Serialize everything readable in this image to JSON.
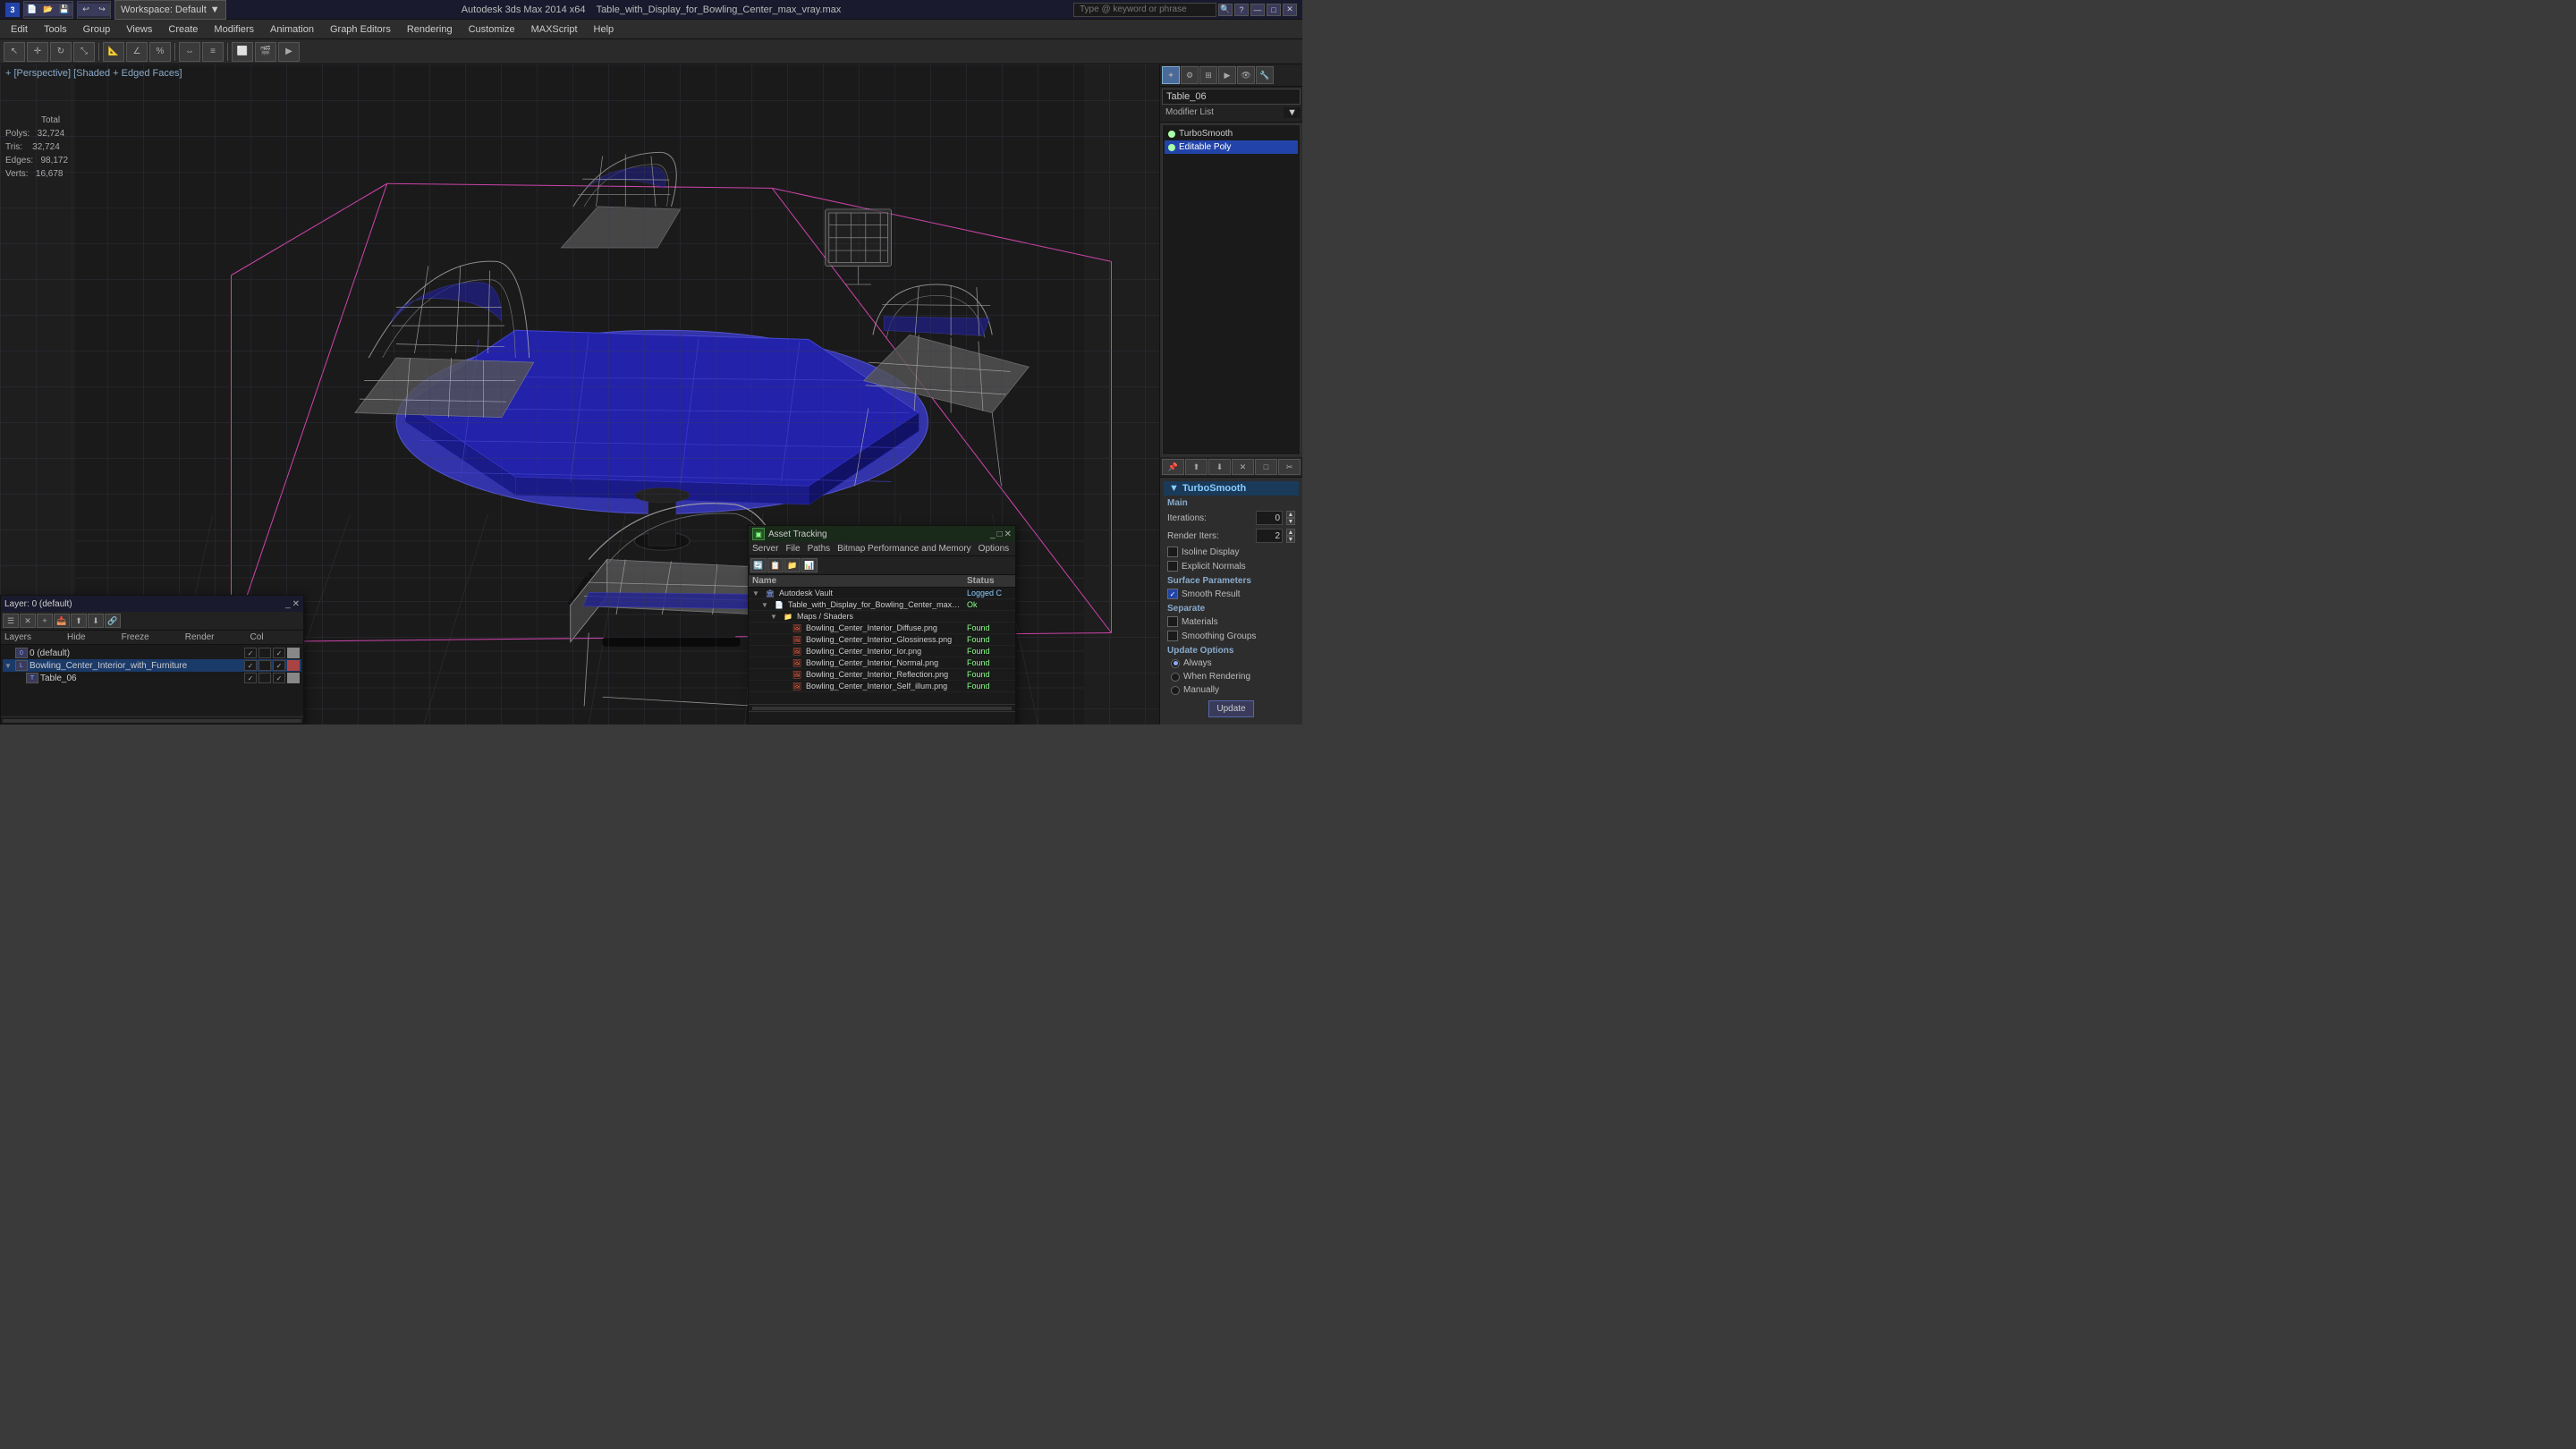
{
  "titlebar": {
    "app_name": "Autodesk 3ds Max 2014 x64",
    "file_name": "Table_with_Display_for_Bowling_Center_max_vray.max",
    "workspace": "Workspace: Default",
    "min_btn": "—",
    "max_btn": "□",
    "close_btn": "✕"
  },
  "search": {
    "placeholder": "Type @ keyword or phrase"
  },
  "menubar": {
    "items": [
      "Edit",
      "Tools",
      "Group",
      "Views",
      "Create",
      "Modifiers",
      "Animation",
      "Graph Editors",
      "Rendering",
      "Customize",
      "MAXScript",
      "Help"
    ]
  },
  "viewport": {
    "label": "+ [Perspective] [Shaded + Edged Faces]",
    "stats": {
      "polys_label": "Polys:",
      "polys_total": "Total",
      "polys_val": "32,724",
      "tris_label": "Tris:",
      "tris_val": "32,724",
      "edges_label": "Edges:",
      "edges_val": "98,172",
      "verts_label": "Verts:",
      "verts_val": "16,678"
    }
  },
  "right_panel": {
    "icons": [
      "☀",
      "⚙",
      "📷",
      "🔧",
      "💡",
      "📱"
    ],
    "object_name": "Table_06",
    "modifier_list_label": "Modifier List",
    "modifiers": [
      {
        "name": "TurboSmooth",
        "active": true
      },
      {
        "name": "Editable Poly",
        "active": true
      }
    ],
    "stack_buttons": [
      "📌",
      "⬆",
      "⬇",
      "✕",
      "□",
      "✂"
    ],
    "turbosmooth": {
      "title": "TurboSmooth",
      "main_label": "Main",
      "iterations_label": "Iterations:",
      "iterations_val": "0",
      "render_iters_label": "Render Iters:",
      "render_iters_val": "2",
      "isoline_label": "Isoline Display",
      "isoline_checked": false,
      "explicit_label": "Explicit Normals",
      "explicit_checked": false,
      "surface_label": "Surface Parameters",
      "smooth_label": "Smooth Result",
      "smooth_checked": true,
      "separate_label": "Separate",
      "materials_label": "Materials",
      "materials_checked": false,
      "smoothing_label": "Smoothing Groups",
      "smoothing_checked": false,
      "update_label": "Update Options",
      "always_label": "Always",
      "always_selected": true,
      "when_rendering_label": "When Rendering",
      "when_rendering_selected": false,
      "manually_label": "Manually",
      "manually_selected": false,
      "update_btn_label": "Update"
    }
  },
  "layers_panel": {
    "title": "Layer: 0 (default)",
    "toolbar_items": [
      "☰",
      "✕",
      "+",
      "📥",
      "⬆",
      "⬇",
      "🔗"
    ],
    "header_cols": [
      "Layers",
      "Hide",
      "Freeze",
      "Render",
      "Col"
    ],
    "layers": [
      {
        "indent": 0,
        "expand": "",
        "name": "0 (default)",
        "visible": true,
        "selected": false
      },
      {
        "indent": 1,
        "expand": "▼",
        "name": "Bowling_Center_Interior_with_Furniture",
        "visible": true,
        "selected": true,
        "color": "#aa4444"
      },
      {
        "indent": 2,
        "expand": "",
        "name": "Table_06",
        "visible": true,
        "selected": false
      }
    ]
  },
  "asset_panel": {
    "title": "Asset Tracking",
    "menu_items": [
      "Server",
      "File",
      "Paths",
      "Bitmap Performance and Memory",
      "Options"
    ],
    "toolbar_items": [
      "🔄",
      "📋",
      "📁",
      "📊"
    ],
    "col_name": "Name",
    "col_status": "Status",
    "items": [
      {
        "indent": 0,
        "expand": "▼",
        "type": "folder",
        "name": "Autodesk Vault",
        "status": "Logged C",
        "status_class": "status-logged"
      },
      {
        "indent": 1,
        "expand": "▼",
        "type": "file",
        "name": "Table_with_Display_for_Bowling_Center_max_vray.max",
        "status": "Ok",
        "status_class": "status-ok"
      },
      {
        "indent": 2,
        "expand": "▼",
        "type": "folder",
        "name": "Maps / Shaders",
        "status": "",
        "status_class": ""
      },
      {
        "indent": 3,
        "expand": "",
        "type": "image",
        "name": "Bowling_Center_Interior_Diffuse.png",
        "status": "Found",
        "status_class": "status-found"
      },
      {
        "indent": 3,
        "expand": "",
        "type": "image",
        "name": "Bowling_Center_Interior_Glossiness.png",
        "status": "Found",
        "status_class": "status-found"
      },
      {
        "indent": 3,
        "expand": "",
        "type": "image",
        "name": "Bowling_Center_Interior_Ior.png",
        "status": "Found",
        "status_class": "status-found"
      },
      {
        "indent": 3,
        "expand": "",
        "type": "image",
        "name": "Bowling_Center_Interior_Normal.png",
        "status": "Found",
        "status_class": "status-found"
      },
      {
        "indent": 3,
        "expand": "",
        "type": "image",
        "name": "Bowling_Center_Interior_Reflection.png",
        "status": "Found",
        "status_class": "status-found"
      },
      {
        "indent": 3,
        "expand": "",
        "type": "image",
        "name": "Bowling_Center_Interior_Self_illum.png",
        "status": "Found",
        "status_class": "status-found"
      }
    ]
  }
}
